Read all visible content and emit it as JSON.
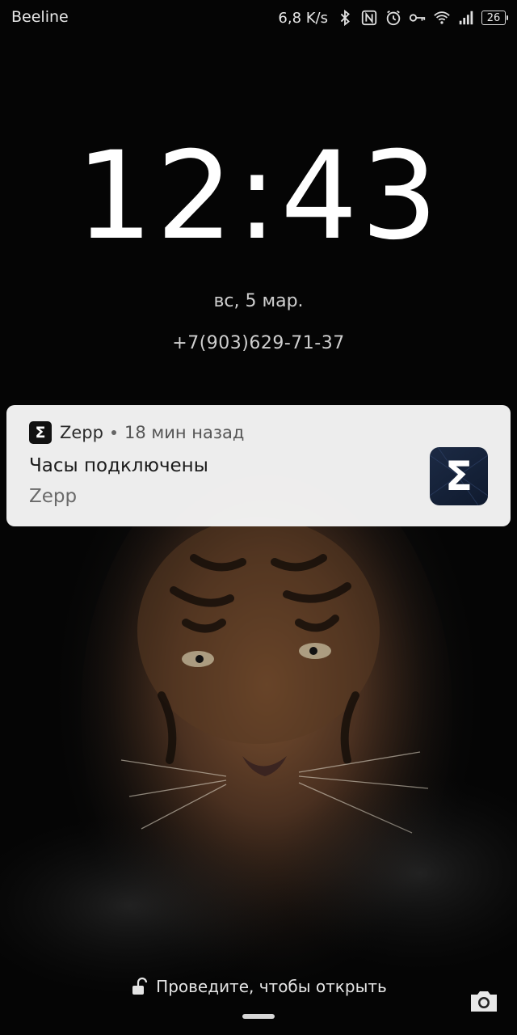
{
  "status_bar": {
    "carrier": "Beeline",
    "net_speed": "6,8 K/s",
    "battery_level": "26",
    "icons": [
      "bluetooth-icon",
      "nfc-icon",
      "alarm-icon",
      "key-icon",
      "wifi-icon",
      "signal-icon",
      "battery-icon"
    ]
  },
  "lock_screen": {
    "time": "12:43",
    "date": "вс, 5 мар.",
    "owner_info": "+7(903)629-71-37"
  },
  "notification": {
    "app_name": "Zepp",
    "app_icon_glyph": "Σ",
    "time_ago": "18 мин назад",
    "title": "Часы подключены",
    "body": "Zepp"
  },
  "bottom": {
    "unlock_hint": "Проведите, чтобы открыть"
  },
  "colors": {
    "notification_bg": "#f5f5f5",
    "app_icon_bg": "#1c2a44",
    "text_primary": "#ffffff"
  }
}
